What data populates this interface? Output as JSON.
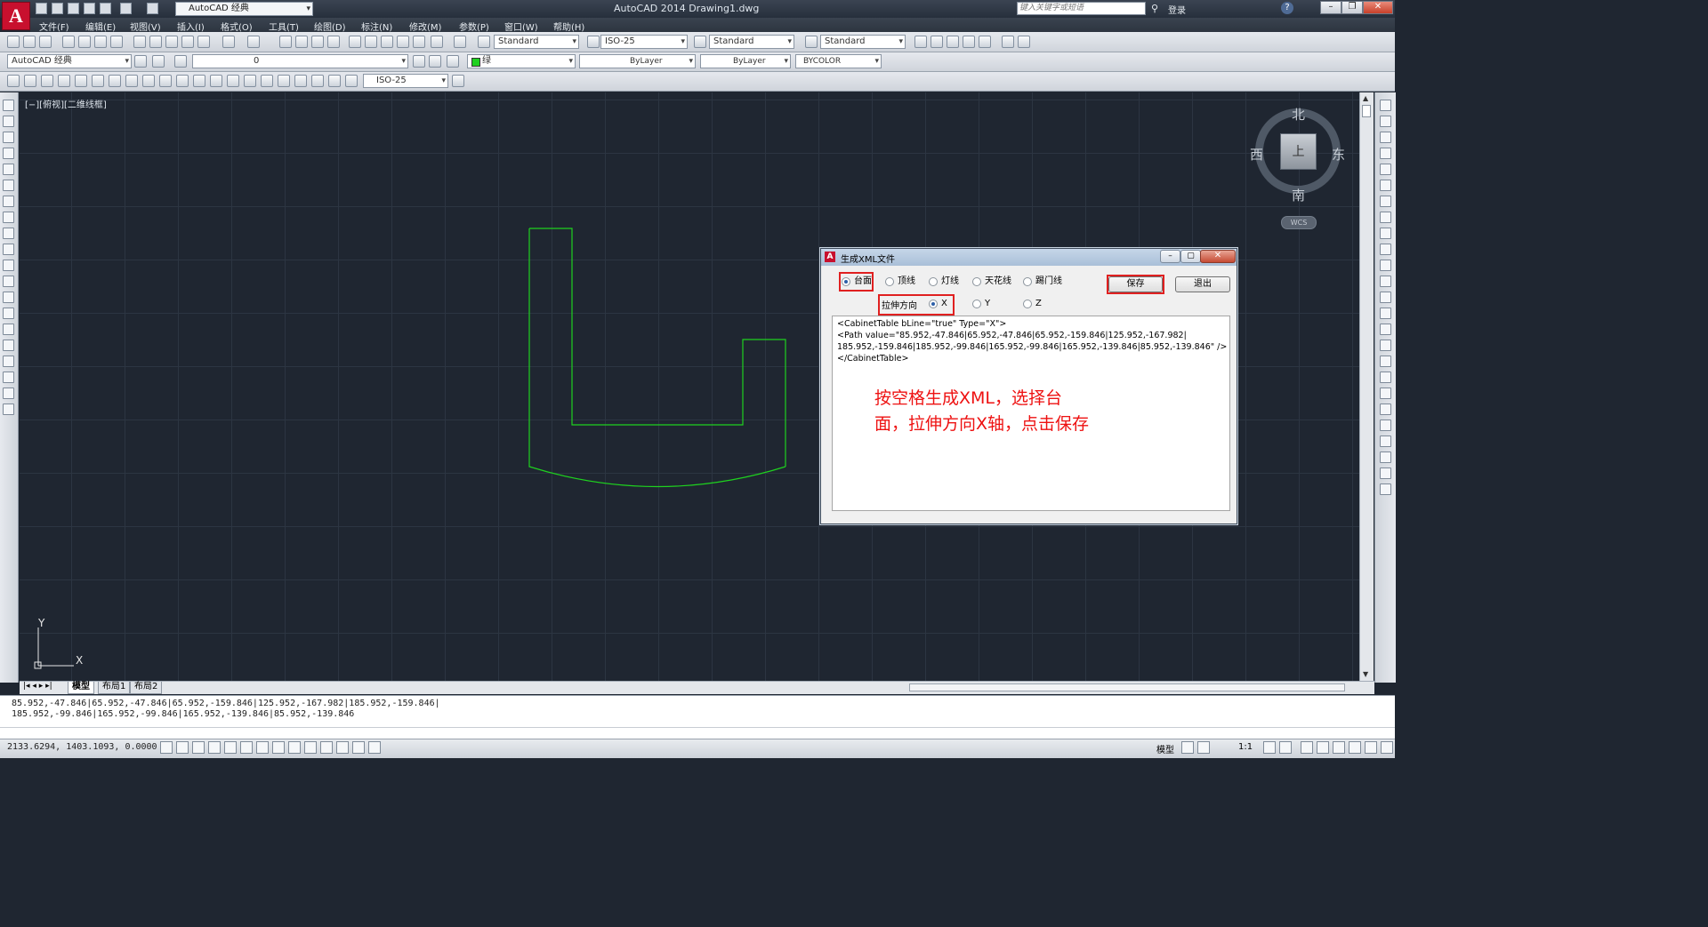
{
  "app": {
    "window_title": "AutoCAD 2014  Drawing1.dwg",
    "workspace": "AutoCAD 经典",
    "search_placeholder": "键入关键字或短语",
    "login": "登录",
    "help": "?"
  },
  "menu": [
    "文件(F)",
    "编辑(E)",
    "视图(V)",
    "插入(I)",
    "格式(O)",
    "工具(T)",
    "绘图(D)",
    "标注(N)",
    "修改(M)",
    "参数(P)",
    "窗口(W)",
    "帮助(H)"
  ],
  "toolbar1": {
    "text_style": "Standard",
    "dim_style": "ISO-25",
    "table_style": "Standard",
    "multileader_style": "Standard"
  },
  "toolbar2": {
    "workspace": "AutoCAD 经典",
    "layer": "0",
    "color": "绿",
    "linetype": "ByLayer",
    "lineweight": "ByLayer",
    "plotstyle": "BYCOLOR"
  },
  "toolbar3": {
    "dim_style": "ISO-25"
  },
  "viewport": {
    "label": "[−][俯视][二维线框]",
    "compass": {
      "north": "北",
      "south": "南",
      "east": "东",
      "west": "西"
    },
    "cube_face": "上",
    "wcs": "WCS",
    "ucs_x": "X",
    "ucs_y": "Y",
    "shape_color": "#1fd11f"
  },
  "layout_tabs": [
    "模型",
    "布局1",
    "布局2"
  ],
  "command": {
    "line1": "85.952,-47.846|65.952,-47.846|65.952,-159.846|125.952,-167.982|185.952,-159.846|",
    "line2": "185.952,-99.846|165.952,-99.846|165.952,-139.846|85.952,-139.846"
  },
  "status": {
    "coords": "2133.6294, 1403.1093, 0.0000",
    "model": "模型",
    "scale": "1:1"
  },
  "dialog": {
    "title": "生成XML文件",
    "types": [
      {
        "label": "台面",
        "checked": true
      },
      {
        "label": "顶线",
        "checked": false
      },
      {
        "label": "灯线",
        "checked": false
      },
      {
        "label": "天花线",
        "checked": false
      },
      {
        "label": "踢门线",
        "checked": false
      }
    ],
    "direction_label": "拉伸方向",
    "directions": [
      {
        "label": "X",
        "checked": true
      },
      {
        "label": "Y",
        "checked": false
      },
      {
        "label": "Z",
        "checked": false
      }
    ],
    "save_button": "保存",
    "exit_button": "退出",
    "xml_lines": [
      "<CabinetTable bLine=\"true\" Type=\"X\">",
      "  <Path value=\"85.952,-47.846|65.952,-47.846|65.952,-159.846|125.952,-167.982|",
      "185.952,-159.846|185.952,-99.846|165.952,-99.846|165.952,-139.846|85.952,-139.846\" />",
      "</CabinetTable>"
    ],
    "note_lines": [
      "按空格生成XML，选择台",
      "面，拉伸方向X轴，点击保存"
    ],
    "highlight_color": "#e02020"
  }
}
